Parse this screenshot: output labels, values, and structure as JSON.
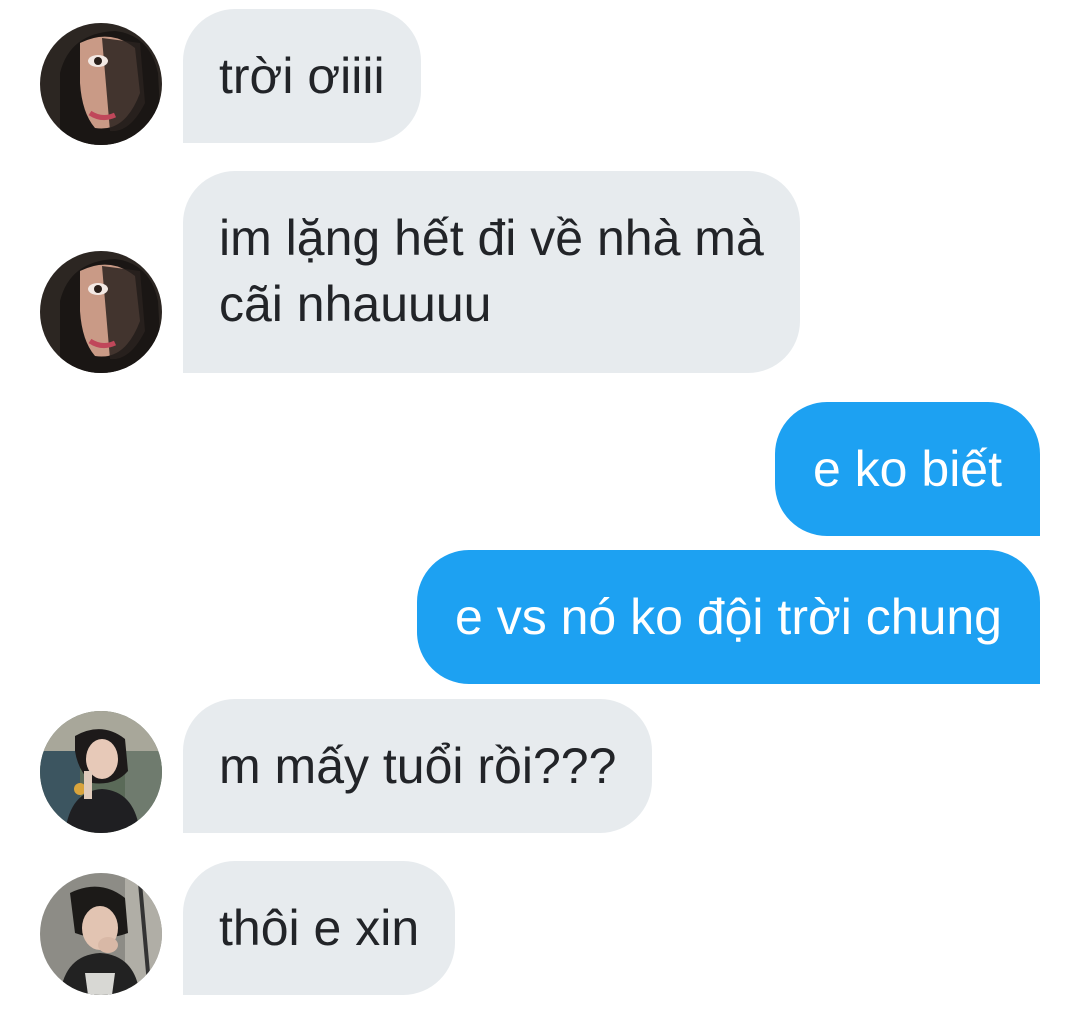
{
  "colors": {
    "incoming_bubble": "#e7ebee",
    "outgoing_bubble": "#1da1f2",
    "incoming_text": "#222428",
    "outgoing_text": "#ffffff"
  },
  "messages": [
    {
      "direction": "incoming",
      "avatar": "avatar-user-a",
      "lines": [
        "trời ơiiii"
      ]
    },
    {
      "direction": "incoming",
      "avatar": "avatar-user-a",
      "lines": [
        "im lặng hết đi về nhà mà",
        "cãi nhauuuu"
      ]
    },
    {
      "direction": "outgoing",
      "lines": [
        "e ko biết"
      ]
    },
    {
      "direction": "outgoing",
      "lines": [
        "e vs nó ko đội trời chung"
      ]
    },
    {
      "direction": "incoming",
      "avatar": "avatar-user-b",
      "lines": [
        "m mấy tuổi rồi???"
      ]
    },
    {
      "direction": "incoming",
      "avatar": "avatar-user-c",
      "lines": [
        "thôi e xin"
      ]
    }
  ]
}
